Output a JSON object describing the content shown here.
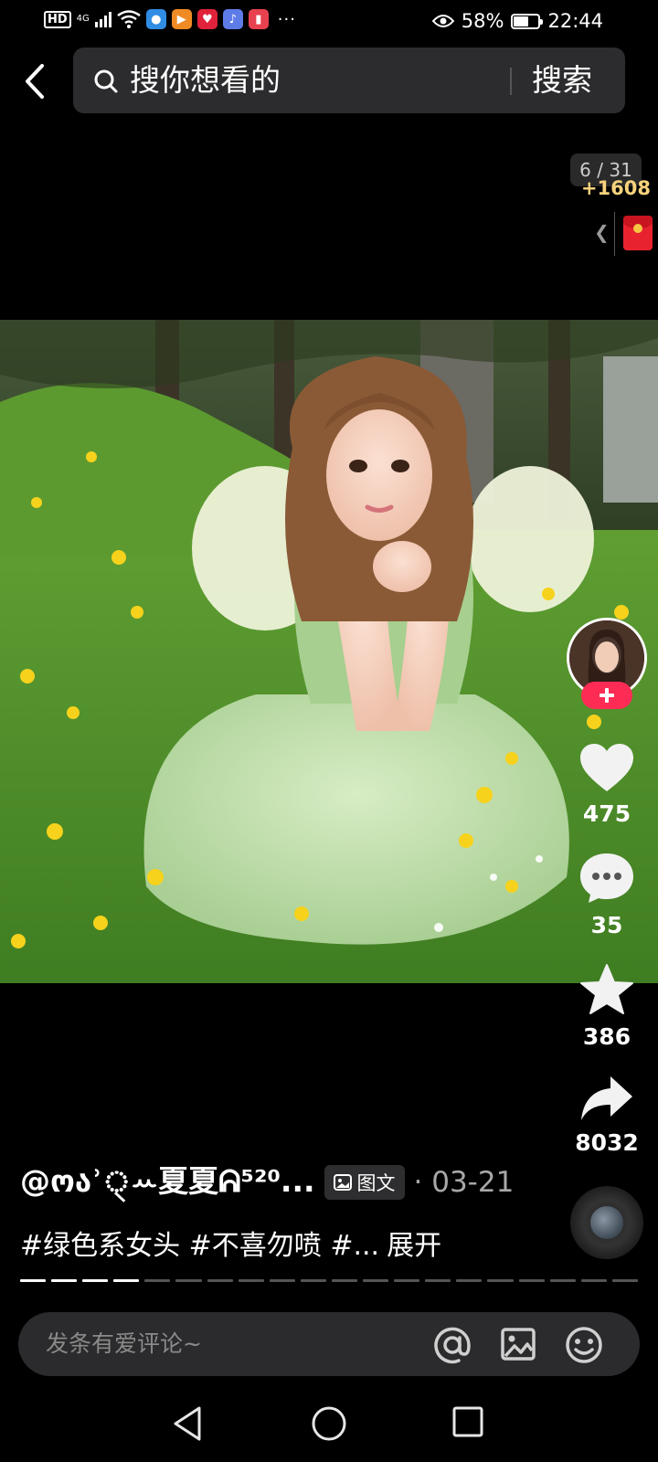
{
  "status_bar": {
    "hd": "HD",
    "network": "4G",
    "battery_percent": "58%",
    "battery_level": 0.58,
    "time": "22:44",
    "more": "···",
    "app_icons": [
      "browser-icon",
      "video-app-icon",
      "red-app-icon",
      "music-app-icon",
      "reader-app-icon"
    ]
  },
  "search": {
    "placeholder": "搜你想看的",
    "button_label": "搜索"
  },
  "page_counter": "6 / 31",
  "reward": {
    "amount": "+1608"
  },
  "post": {
    "author": "@ოაʾ্ꕀ夏夏ᕱ⁵²⁰...",
    "post_type": "图文",
    "date": "· 03-21",
    "caption": "#绿色系女头 #不喜勿喷 #...",
    "expand_label": "展开",
    "current_image": 6,
    "total_images": 31
  },
  "actions": {
    "likes": "475",
    "comments": "35",
    "favorites": "386",
    "shares": "8032"
  },
  "comment_bar": {
    "placeholder": "发条有爱评论~"
  },
  "colors": {
    "follow_accent": "#fe2c55",
    "reward_gold": "#f6d27c",
    "reward_red": "#e8232f"
  }
}
